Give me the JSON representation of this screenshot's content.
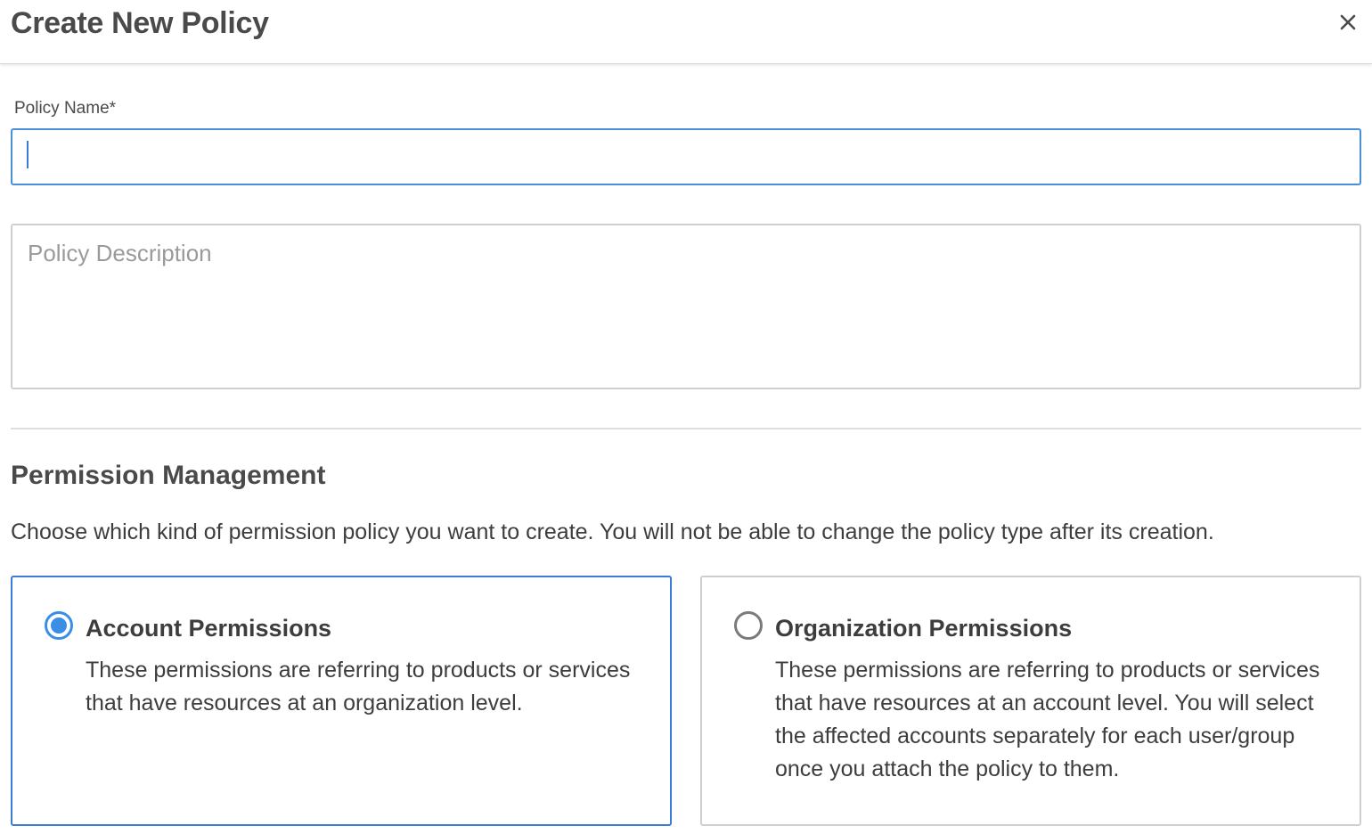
{
  "dialog": {
    "title": "Create New Policy",
    "close_icon": "close-icon"
  },
  "form": {
    "policy_name_label": "Policy Name*",
    "policy_name_value": "",
    "policy_description_placeholder": "Policy Description",
    "policy_description_value": ""
  },
  "permissions": {
    "title": "Permission Management",
    "description": "Choose which kind of permission policy you want to create. You will not be able to change the policy type after its creation.",
    "options": [
      {
        "label": "Account Permissions",
        "description": "These permissions are referring to products or services that have resources at an organization level.",
        "selected": true
      },
      {
        "label": "Organization Permissions",
        "description": "These permissions are referring to products or services that have resources at an account level. You will select the affected accounts separately for each user/group once you attach the policy to them.",
        "selected": false
      }
    ]
  },
  "colors": {
    "accent": "#3a8ee6",
    "focus_border": "#4a90d9",
    "border": "#cfcfcf",
    "text": "#3d3d3d"
  }
}
